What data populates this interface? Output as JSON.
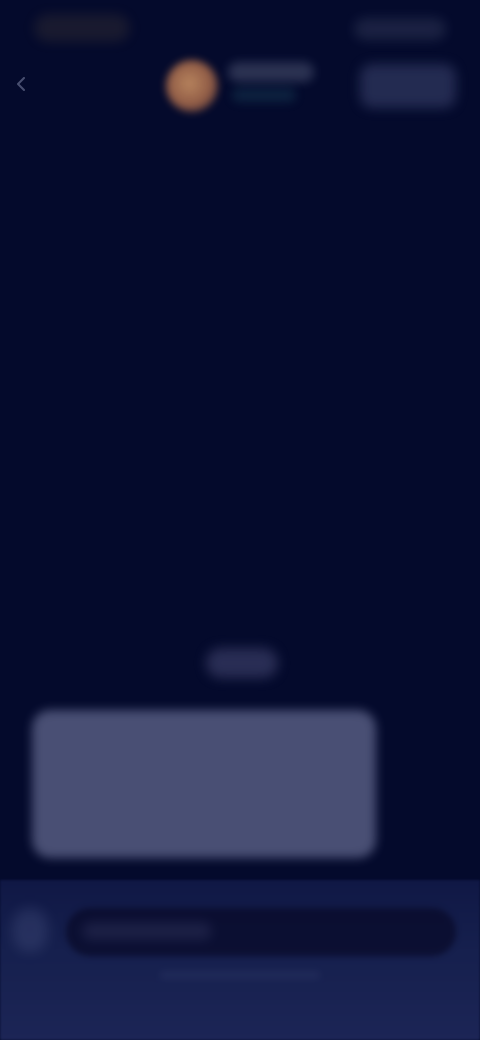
{
  "status_bar": {
    "time": "",
    "icons": [
      "signal-icon",
      "wifi-icon",
      "battery-icon"
    ]
  },
  "header": {
    "back_icon": "chevron-left-icon",
    "contact_name": "",
    "contact_status": "",
    "action_label": ""
  },
  "chat": {
    "date_chip": "",
    "message_text": ""
  },
  "composer": {
    "attach_icon": "paperclip-icon",
    "placeholder": ""
  },
  "colors": {
    "background": "#040a2c",
    "bubble": "#4d5378",
    "composer": "#1c2556",
    "avatar": "#d79a67",
    "status_accent": "#3ca0aa"
  }
}
